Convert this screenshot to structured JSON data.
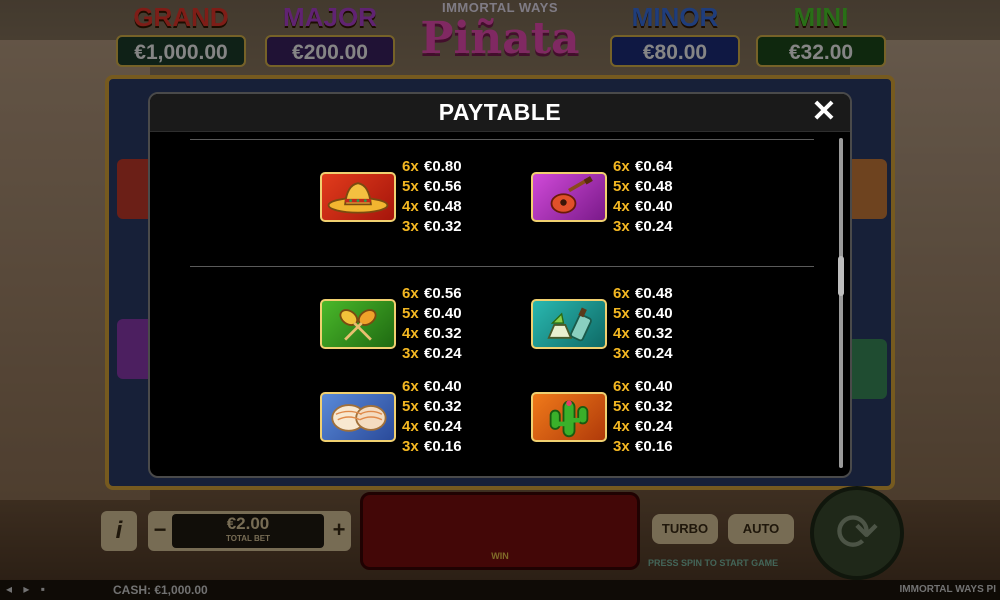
{
  "jackpots": {
    "grand": {
      "label": "GRAND",
      "value": "€1,000.00"
    },
    "major": {
      "label": "MAJOR",
      "value": "€200.00"
    },
    "minor": {
      "label": "MINOR",
      "value": "€80.00"
    },
    "mini": {
      "label": "MINI",
      "value": "€32.00"
    }
  },
  "logo": {
    "top": "IMMORTAL WAYS",
    "main": "Piñata"
  },
  "paytable": {
    "title": "PAYTABLE",
    "close_glyph": "✕",
    "symbols": [
      {
        "icon": "sombrero-icon",
        "pays": [
          {
            "count": "6x",
            "amount": "€0.80"
          },
          {
            "count": "5x",
            "amount": "€0.56"
          },
          {
            "count": "4x",
            "amount": "€0.48"
          },
          {
            "count": "3x",
            "amount": "€0.32"
          }
        ]
      },
      {
        "icon": "guitar-icon",
        "pays": [
          {
            "count": "6x",
            "amount": "€0.64"
          },
          {
            "count": "5x",
            "amount": "€0.48"
          },
          {
            "count": "4x",
            "amount": "€0.40"
          },
          {
            "count": "3x",
            "amount": "€0.24"
          }
        ]
      },
      {
        "icon": "maracas-icon",
        "pays": [
          {
            "count": "6x",
            "amount": "€0.56"
          },
          {
            "count": "5x",
            "amount": "€0.40"
          },
          {
            "count": "4x",
            "amount": "€0.32"
          },
          {
            "count": "3x",
            "amount": "€0.24"
          }
        ]
      },
      {
        "icon": "tequila-icon",
        "pays": [
          {
            "count": "6x",
            "amount": "€0.48"
          },
          {
            "count": "5x",
            "amount": "€0.40"
          },
          {
            "count": "4x",
            "amount": "€0.32"
          },
          {
            "count": "3x",
            "amount": "€0.24"
          }
        ]
      },
      {
        "icon": "conchas-bread-icon",
        "pays": [
          {
            "count": "6x",
            "amount": "€0.40"
          },
          {
            "count": "5x",
            "amount": "€0.32"
          },
          {
            "count": "4x",
            "amount": "€0.24"
          },
          {
            "count": "3x",
            "amount": "€0.16"
          }
        ]
      },
      {
        "icon": "cactus-icon",
        "pays": [
          {
            "count": "6x",
            "amount": "€0.40"
          },
          {
            "count": "5x",
            "amount": "€0.32"
          },
          {
            "count": "4x",
            "amount": "€0.24"
          },
          {
            "count": "3x",
            "amount": "€0.16"
          }
        ]
      }
    ]
  },
  "controls": {
    "info_label": "i",
    "minus_label": "−",
    "plus_label": "+",
    "bet_value": "€2.00",
    "bet_label": "TOTAL BET",
    "win_label": "WIN",
    "turbo_label": "TURBO",
    "auto_label": "AUTO",
    "press_text": "PRESS SPIN TO START GAME",
    "spin_glyph": "⟳"
  },
  "status_bar": {
    "icons": "◂ ▸ ▪",
    "cash": "CASH: €1,000.00",
    "brand": "IMMORTAL WAYS PI"
  },
  "colors": {
    "count_gold": "#f3b722",
    "modal_bg": "#000000",
    "tile_border": "#f0d070"
  }
}
